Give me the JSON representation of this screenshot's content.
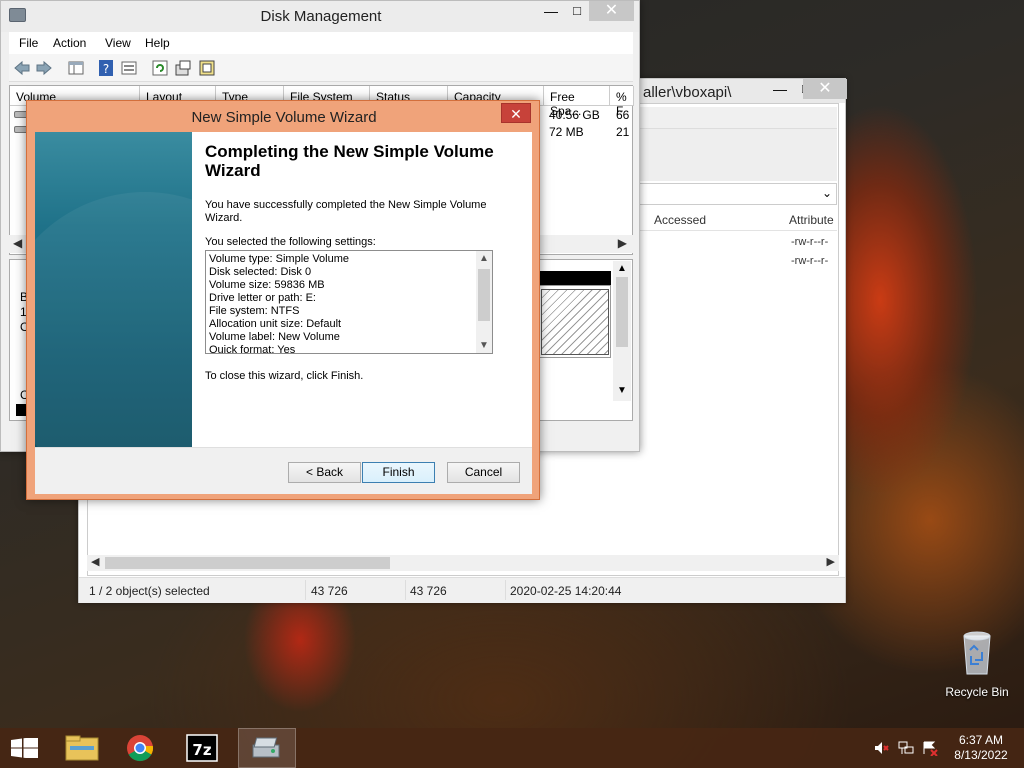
{
  "explorer_window": {
    "title_fragment": "aller\\vboxapi\\",
    "columns": [
      "Accessed",
      "Attribute"
    ],
    "rows": [
      {
        "attr": "-rw-r--r-"
      },
      {
        "attr": "-rw-r--r-"
      }
    ],
    "status": {
      "selected": "1 / 2 object(s) selected",
      "size1": "43 726",
      "size2": "43 726",
      "date": "2020-02-25 14:20:44"
    }
  },
  "disk_management": {
    "title": "Disk Management",
    "menu": [
      "File",
      "Action",
      "View",
      "Help"
    ],
    "columns": [
      "Volume",
      "Layout",
      "Type",
      "File System",
      "Status",
      "Capacity",
      "Free Spa...",
      "% F"
    ],
    "rows": [
      {
        "free": "40.56 GB",
        "pct": "66"
      },
      {
        "free": "72 MB",
        "pct": "21"
      }
    ],
    "lower_left": [
      "B",
      "1.",
      "O",
      "C"
    ]
  },
  "wizard": {
    "title": "New Simple Volume Wizard",
    "heading": "Completing the New Simple Volume Wizard",
    "intro": "You have successfully completed the New Simple Volume Wizard.",
    "settings_label": "You selected the following settings:",
    "settings": [
      "Volume type: Simple Volume",
      "Disk selected: Disk 0",
      "Volume size: 59836 MB",
      "Drive letter or path: E:",
      "File system: NTFS",
      "Allocation unit size: Default",
      "Volume label: New Volume",
      "Quick format: Yes"
    ],
    "close_note": "To close this wizard, click Finish.",
    "buttons": {
      "back": "< Back",
      "finish": "Finish",
      "cancel": "Cancel"
    }
  },
  "desktop": {
    "recycle_bin": "Recycle Bin"
  },
  "taskbar": {
    "apps": [
      "File Explorer",
      "Google Chrome",
      "7-Zip",
      "Disk Management"
    ],
    "time": "6:37 AM",
    "date": "8/13/2022"
  },
  "colors": {
    "wizard_frame": "#f0a37a",
    "wizard_close": "#c7423a",
    "wizard_side": "#1f7289",
    "taskbar": "#46261"
  }
}
